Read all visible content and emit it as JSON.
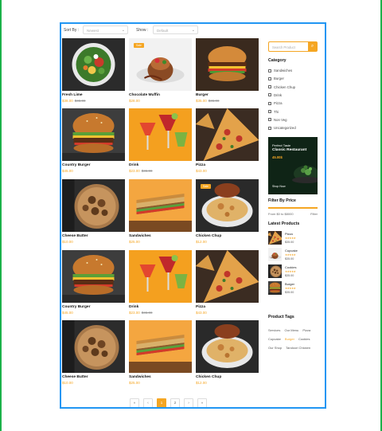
{
  "sort": {
    "label": "Sort By :",
    "value": "Newest",
    "show_label": "Show :",
    "show_value": "Default"
  },
  "products": [
    {
      "name": "Fresh Lime",
      "price": "$38.00",
      "old_price": "$45.00",
      "sale": "",
      "kind": "salad"
    },
    {
      "name": "Chocolate Muffin",
      "price": "$28.00",
      "old_price": "",
      "sale": "Sale",
      "kind": "dessert"
    },
    {
      "name": "Burger",
      "price": "$35.00",
      "old_price": "$45.00",
      "sale": "",
      "kind": "burger2"
    },
    {
      "name": "Country Burger",
      "price": "$45.00",
      "old_price": "",
      "sale": "",
      "kind": "burger"
    },
    {
      "name": "Drink",
      "price": "$23.00",
      "old_price": "$45.00",
      "sale": "",
      "kind": "drink"
    },
    {
      "name": "Pizza",
      "price": "$43.00",
      "old_price": "",
      "sale": "",
      "kind": "pizza"
    },
    {
      "name": "Cheese Butter",
      "price": "$10.00",
      "old_price": "",
      "sale": "",
      "kind": "cheese"
    },
    {
      "name": "Sandwiches",
      "price": "$25.00",
      "old_price": "",
      "sale": "",
      "kind": "sandwich"
    },
    {
      "name": "Chicken Chup",
      "price": "$12.00",
      "old_price": "",
      "sale": "Sale",
      "kind": "chicken"
    },
    {
      "name": "Country Burger",
      "price": "$45.00",
      "old_price": "",
      "sale": "",
      "kind": "burger"
    },
    {
      "name": "Drink",
      "price": "$23.00",
      "old_price": "$45.00",
      "sale": "",
      "kind": "drink"
    },
    {
      "name": "Pizza",
      "price": "$43.00",
      "old_price": "",
      "sale": "",
      "kind": "pizza"
    },
    {
      "name": "Cheese Butter",
      "price": "$10.00",
      "old_price": "",
      "sale": "",
      "kind": "cheese"
    },
    {
      "name": "Sandwiches",
      "price": "$25.00",
      "old_price": "",
      "sale": "",
      "kind": "sandwich"
    },
    {
      "name": "Chicken Chup",
      "price": "$12.00",
      "old_price": "",
      "sale": "",
      "kind": "chicken"
    }
  ],
  "sidebar": {
    "search_placeholder": "Search Product",
    "category_title": "Category",
    "categories": [
      "Sandwiches",
      "Burger",
      "Chicken Chup",
      "Drink",
      "Pizza",
      "Thi",
      "Non Veg",
      "Uncategorized"
    ],
    "promo": {
      "line1": "Perfect Taste",
      "line2": "Classic Restaurant",
      "price": "45.00$",
      "cta": "Shop Now"
    },
    "filter_title": "Filter By Price",
    "price_range": "From $0 to $8000",
    "filter_btn": "Filter",
    "latest_title": "Latest Products",
    "latest": [
      {
        "name": "Pizza",
        "stars": "★★★★★",
        "price": "$35.00",
        "kind": "pizza"
      },
      {
        "name": "Cupcake",
        "stars": "★★★★★",
        "price": "$35.00",
        "kind": "dessert"
      },
      {
        "name": "Cookies",
        "stars": "★★★★★",
        "price": "$35.00",
        "kind": "cheese"
      },
      {
        "name": "Burger",
        "stars": "★★★★★",
        "price": "$35.00",
        "kind": "burger"
      }
    ],
    "tags_title": "Product Tags",
    "tags": [
      "Services",
      "Our Menu",
      "Pizza",
      "Cupcake",
      "Burger",
      "Cookies",
      "Our Shop",
      "Tandoori Chicken"
    ]
  },
  "pagination": {
    "first": "«",
    "prev": "‹",
    "pages": [
      "1",
      "2"
    ],
    "next": "›",
    "last": "»"
  },
  "colors": {
    "accent": "#f5a623",
    "frame": "#2196f3"
  }
}
